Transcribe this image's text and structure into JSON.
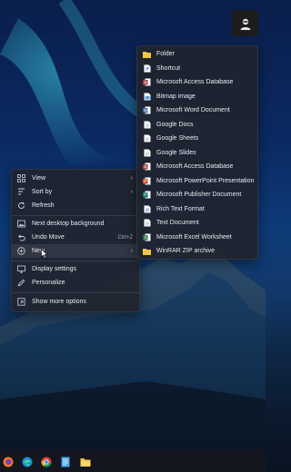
{
  "context_menu": {
    "items": [
      {
        "label": "View",
        "icon": "grid-icon",
        "submenu": true
      },
      {
        "label": "Sort by",
        "icon": "sort-icon",
        "submenu": true
      },
      {
        "label": "Refresh",
        "icon": "refresh-icon"
      },
      {
        "label": "Next desktop background",
        "icon": "image-icon"
      },
      {
        "label": "Undo Move",
        "icon": "undo-icon",
        "shortcut": "Ctrl+Z"
      },
      {
        "label": "New",
        "icon": "new-icon",
        "submenu": true
      },
      {
        "label": "Display settings",
        "icon": "display-icon"
      },
      {
        "label": "Personalize",
        "icon": "pen-icon"
      },
      {
        "label": "Show more options",
        "icon": "more-options-icon"
      }
    ]
  },
  "new_submenu": {
    "items": [
      {
        "label": "Folder",
        "icon": "folder-icon"
      },
      {
        "label": "Shortcut",
        "icon": "shortcut-icon"
      },
      {
        "label": "Microsoft Access Database",
        "icon": "access-icon"
      },
      {
        "label": "Bitmap image",
        "icon": "bitmap-icon"
      },
      {
        "label": "Microsoft Word Document",
        "icon": "word-icon"
      },
      {
        "label": "Google Docs",
        "icon": "document-icon"
      },
      {
        "label": "Google Sheets",
        "icon": "document-icon"
      },
      {
        "label": "Google Slides",
        "icon": "document-icon"
      },
      {
        "label": "Microsoft Access Database",
        "icon": "access-icon"
      },
      {
        "label": "Microsoft PowerPoint Presentation",
        "icon": "powerpoint-icon"
      },
      {
        "label": "Microsoft Publisher Document",
        "icon": "publisher-icon"
      },
      {
        "label": "Rich Text Format",
        "icon": "document-icon"
      },
      {
        "label": "Text Document",
        "icon": "document-icon"
      },
      {
        "label": "Microsoft Excel Worksheet",
        "icon": "excel-icon"
      },
      {
        "label": "WinRAR ZIP archive",
        "icon": "folder-icon"
      }
    ]
  },
  "taskbar": {
    "apps": [
      "firefox-icon",
      "edge-icon",
      "chrome-icon",
      "notepad-icon",
      "file-explorer-icon"
    ]
  }
}
